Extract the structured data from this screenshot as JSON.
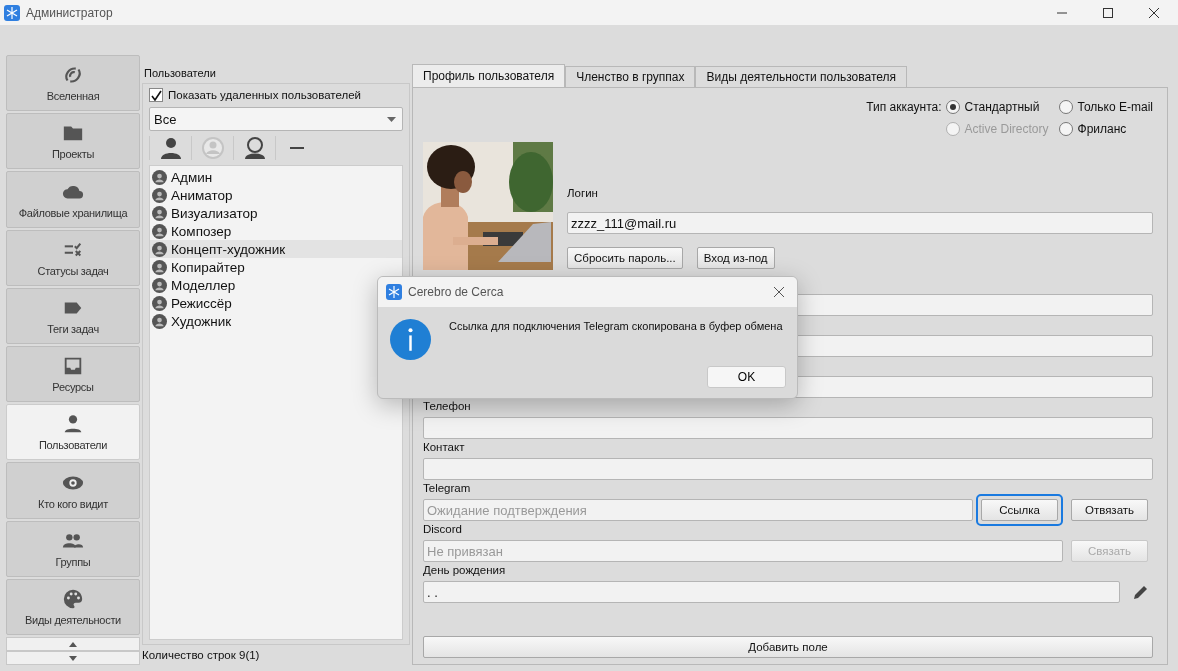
{
  "window": {
    "title": "Администратор"
  },
  "nav": {
    "items": [
      {
        "label": "Вселенная",
        "selected": false
      },
      {
        "label": "Проекты",
        "selected": false
      },
      {
        "label": "Файловые хранилища",
        "selected": false
      },
      {
        "label": "Статусы задач",
        "selected": false
      },
      {
        "label": "Теги задач",
        "selected": false
      },
      {
        "label": "Ресурсы",
        "selected": false
      },
      {
        "label": "Пользователи",
        "selected": true
      },
      {
        "label": "Кто кого видит",
        "selected": false
      },
      {
        "label": "Группы",
        "selected": false
      },
      {
        "label": "Виды деятельности",
        "selected": false
      }
    ]
  },
  "users": {
    "title": "Пользователи",
    "show_deleted": {
      "label": "Показать удаленных пользователей",
      "checked": true
    },
    "filter": {
      "value": "Все"
    },
    "toolbar": [
      {
        "disabled": false
      },
      {
        "disabled": true
      },
      {
        "disabled": false
      },
      {
        "disabled": false
      }
    ],
    "list": [
      {
        "name": "Админ",
        "selected": false
      },
      {
        "name": "Аниматор",
        "selected": false
      },
      {
        "name": "Визуализатор",
        "selected": false
      },
      {
        "name": "Композер",
        "selected": false
      },
      {
        "name": "Концепт-художник",
        "selected": true
      },
      {
        "name": "Копирайтер",
        "selected": false
      },
      {
        "name": "Моделлер",
        "selected": false
      },
      {
        "name": "Режиссёр",
        "selected": false
      },
      {
        "name": "Художник",
        "selected": false
      }
    ],
    "footer": "Количество строк 9(1)"
  },
  "tabs": [
    {
      "label": "Профиль пользователя",
      "selected": true
    },
    {
      "label": "Членство в группах",
      "selected": false
    },
    {
      "label": "Виды деятельности пользователя",
      "selected": false
    }
  ],
  "account_type": {
    "label": "Тип аккаунта:",
    "options": [
      {
        "label": "Стандартный",
        "selected": true,
        "disabled": false
      },
      {
        "label": "Только E-mail",
        "selected": false,
        "disabled": false
      },
      {
        "label": "Active Directory",
        "selected": false,
        "disabled": true
      },
      {
        "label": "Фриланс",
        "selected": false,
        "disabled": false
      }
    ]
  },
  "login": {
    "label": "Логин",
    "value": "zzzz_111@mail.ru",
    "buttons": [
      "Сбросить пароль...",
      "Вход из-под"
    ]
  },
  "fields": [
    {
      "kind": "plain"
    },
    {
      "kind": "plain"
    },
    {
      "kind": "plain"
    },
    {
      "kind": "plain",
      "label": "Телефон"
    },
    {
      "kind": "plain",
      "label": "Контакт"
    },
    {
      "kind": "link",
      "label": "Telegram",
      "placeholder": "Ожидание подтверждения",
      "buttons": [
        {
          "label": "Ссылка",
          "focused": true,
          "disabled": false
        },
        {
          "label": "Отвязать",
          "focused": false,
          "disabled": false
        }
      ]
    },
    {
      "kind": "link",
      "label": "Discord",
      "placeholder": "Не привязан",
      "buttons": [
        {
          "label": "Связать",
          "focused": false,
          "disabled": true
        }
      ]
    },
    {
      "kind": "date",
      "label": "День рождения",
      "value": ". ."
    }
  ],
  "add_field": "Добавить поле",
  "dialog": {
    "title": "Cerebro de Cerca",
    "message": "Ссылка для подключения Telegram скопирована в буфер обмена",
    "button": "OK"
  }
}
